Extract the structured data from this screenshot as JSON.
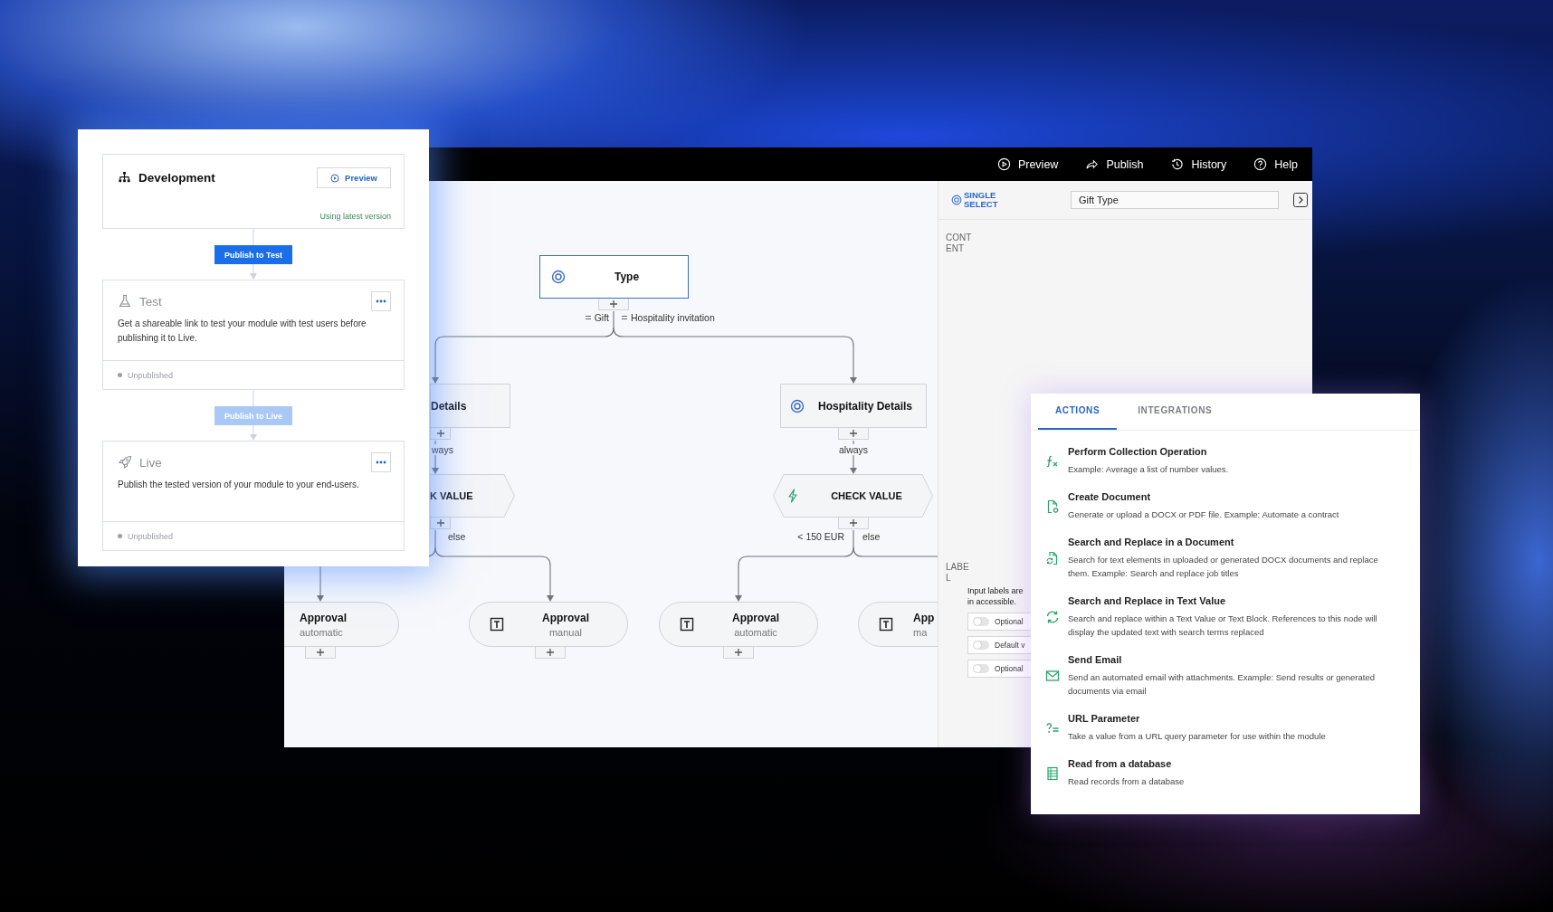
{
  "pipeline_panel": {
    "stages": [
      {
        "kind": "current",
        "title": "Development",
        "preview_button": "Preview",
        "status": "Using latest version"
      },
      {
        "kind": "target",
        "title": "Test",
        "description": "Get a shareable link to test your module with test users before publishing it to Live.",
        "status": "Unpublished"
      },
      {
        "kind": "target",
        "title": "Live",
        "description": "Publish the tested version of your module to your end-users.",
        "status": "Unpublished"
      }
    ],
    "publish_buttons": [
      {
        "label": "Publish to Test",
        "disabled": false
      },
      {
        "label": "Publish to Live",
        "disabled": true
      }
    ]
  },
  "editor": {
    "toolbar": [
      {
        "label": "Preview"
      },
      {
        "label": "Publish"
      },
      {
        "label": "History"
      },
      {
        "label": "Help"
      }
    ],
    "canvas": {
      "nodes": [
        {
          "kind": "select",
          "title": "Type",
          "selected": true
        },
        {
          "kind": "select",
          "title": "Details",
          "selected": false
        },
        {
          "kind": "select",
          "title": "Hospitality Details",
          "selected": false
        },
        {
          "kind": "check",
          "title": "K VALUE",
          "selected": false
        },
        {
          "kind": "check",
          "title": "CHECK VALUE",
          "selected": false
        },
        {
          "kind": "text",
          "title": "Approval",
          "subtitle": "automatic",
          "selected": false
        },
        {
          "kind": "text",
          "title": "Approval",
          "subtitle": "manual",
          "selected": false
        },
        {
          "kind": "text",
          "title": "Approval",
          "subtitle": "automatic",
          "selected": false
        },
        {
          "kind": "text",
          "title": "App",
          "subtitle": "ma",
          "selected": false
        }
      ],
      "edge_labels": [
        {
          "kind": "option",
          "text": "Gift"
        },
        {
          "kind": "option",
          "text": "Hospitality invitation"
        },
        {
          "kind": "rule",
          "text": "ways"
        },
        {
          "kind": "rule",
          "text": "always"
        },
        {
          "kind": "rule",
          "text": "else"
        },
        {
          "kind": "rule",
          "text": "< 150 EUR"
        },
        {
          "kind": "rule",
          "text": "else"
        }
      ]
    },
    "properties": {
      "type_label": "SINGLE SELECT",
      "name_field": {
        "value": "Gift Type"
      },
      "sections": [
        {
          "label": "CONTENT"
        },
        {
          "label": "LABEL",
          "hint": "Input labels are in accessible."
        }
      ],
      "options": [
        {
          "label": "Optional",
          "on": false
        },
        {
          "label": "Default v",
          "on": false
        },
        {
          "label": "Optional",
          "on": false
        }
      ]
    }
  },
  "actions_panel": {
    "tabs": [
      {
        "label": "ACTIONS",
        "selected": true
      },
      {
        "label": "INTEGRATIONS",
        "selected": false
      }
    ],
    "items": [
      {
        "title": "Perform Collection Operation",
        "description": "Example: Average a list of number values."
      },
      {
        "title": "Create Document",
        "description": "Generate or upload a DOCX or PDF file. Example: Automate a contract"
      },
      {
        "title": "Search and Replace in a Document",
        "description": "Search for text elements in uploaded or generated DOCX documents and replace them. Example: Search and replace job titles"
      },
      {
        "title": "Search and Replace in Text Value",
        "description": "Search and replace within a Text Value or Text Block. References to this node will display the updated text with search terms replaced"
      },
      {
        "title": "Send Email",
        "description": "Send an automated email with attachments. Example: Send results or generated documents via email"
      },
      {
        "title": "URL Parameter",
        "description": "Take a value from a URL query parameter for use within the module"
      },
      {
        "title": "Read from a database",
        "description": "Read records from a database"
      }
    ]
  }
}
